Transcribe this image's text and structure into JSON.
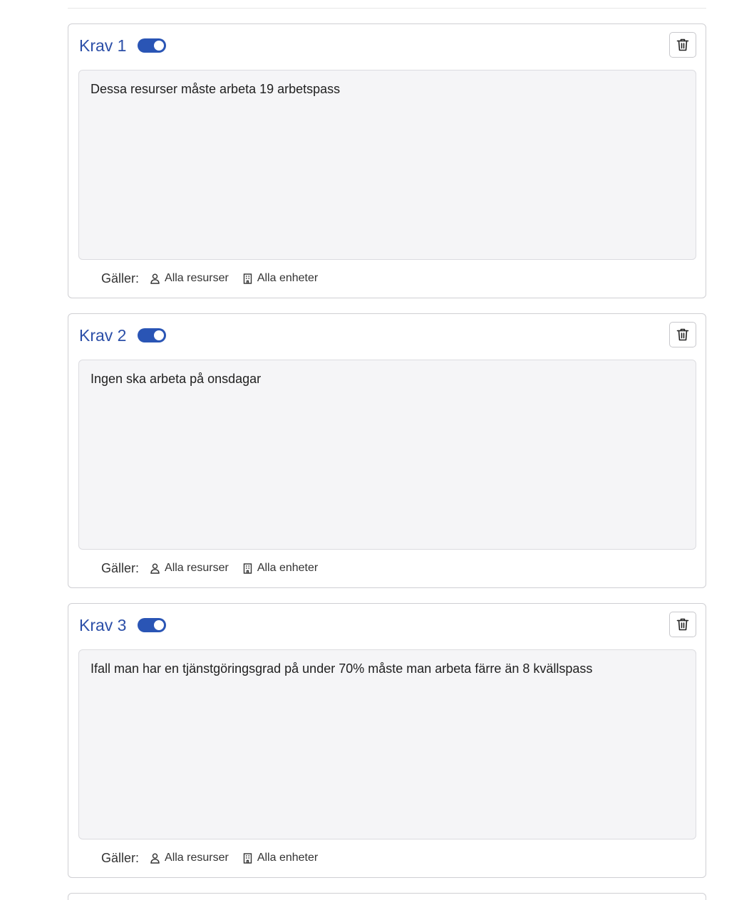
{
  "cards": [
    {
      "title": "Krav 1",
      "enabled": true,
      "text": "Dessa resurser måste arbeta 19 arbetspass",
      "applies_label": "Gäller:",
      "resources_label": "Alla resurser",
      "units_label": "Alla enheter"
    },
    {
      "title": "Krav 2",
      "enabled": true,
      "text": "Ingen ska arbeta på onsdagar",
      "applies_label": "Gäller:",
      "resources_label": "Alla resurser",
      "units_label": "Alla enheter"
    },
    {
      "title": "Krav 3",
      "enabled": true,
      "text": "Ifall man har en tjänstgöringsgrad på under 70% måste man arbeta färre än 8 kvällspass",
      "applies_label": "Gäller:",
      "resources_label": "Alla resurser",
      "units_label": "Alla enheter"
    }
  ],
  "icons": {
    "delete": "trash-icon",
    "resources": "person-icon",
    "units": "building-icon"
  },
  "colors": {
    "accent": "#2a55b5",
    "title": "#2c4fa8",
    "textarea_bg": "#f5f5f7",
    "border": "#cfcfd3"
  }
}
